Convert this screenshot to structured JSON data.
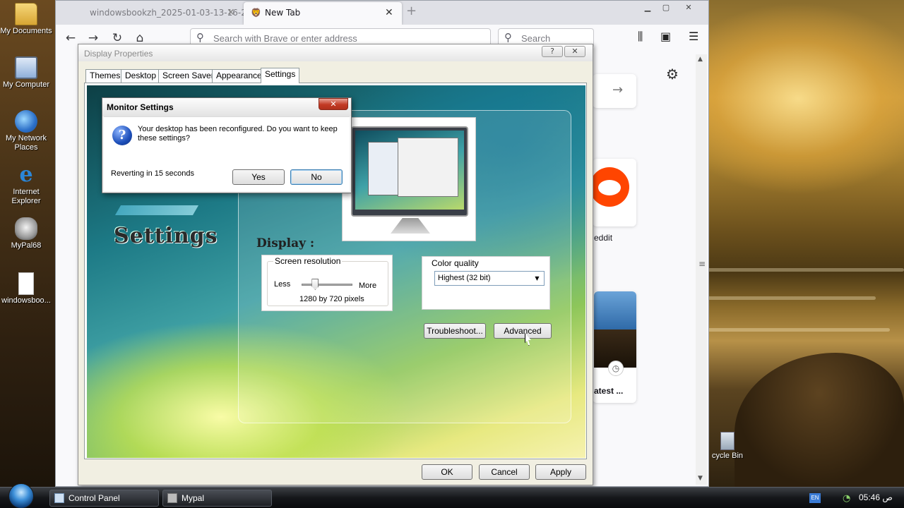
{
  "desktop": {
    "icons": [
      {
        "label": "My Documents",
        "icon": "folder-icon"
      },
      {
        "label": "My Computer",
        "icon": "computer-icon"
      },
      {
        "label": "My Network Places",
        "icon": "network-icon"
      },
      {
        "label": "Internet Explorer",
        "icon": "ie-icon"
      },
      {
        "label": "MyPal68",
        "icon": "mypal-icon"
      },
      {
        "label": "windowsboo...",
        "icon": "file-icon"
      }
    ],
    "recycle_bin_label": "cycle Bin"
  },
  "browser": {
    "tabs": [
      {
        "title": "windowsbookzh_2025-01-03-13-16-2",
        "active": false
      },
      {
        "title": "New Tab",
        "active": true
      }
    ],
    "address_placeholder": "Search with Brave or enter address",
    "search_placeholder": "Search",
    "tiles": [
      {
        "label": "eddit"
      },
      {
        "label": "atest ..."
      }
    ]
  },
  "display_properties": {
    "title": "Display Properties",
    "help_label": "?",
    "close_label": "✕",
    "tabs": [
      "Themes",
      "Desktop",
      "Screen Saver",
      "Appearance",
      "Settings"
    ],
    "active_tab": "Settings",
    "header_word": "Settings",
    "display_label": "Display :",
    "screen_resolution": {
      "title": "Screen resolution",
      "less": "Less",
      "more": "More",
      "value": "1280 by 720 pixels",
      "slider_fraction": 0.2
    },
    "color_quality": {
      "title": "Color quality",
      "selected": "Highest (32 bit)"
    },
    "troubleshoot_label": "Troubleshoot...",
    "advanced_label": "Advanced",
    "ok_label": "OK",
    "cancel_label": "Cancel",
    "apply_label": "Apply"
  },
  "monitor_settings": {
    "title": "Monitor Settings",
    "message": "Your desktop has been reconfigured.  Do you want to keep these settings?",
    "revert_text": "Reverting in 15 seconds",
    "yes_label": "Yes",
    "no_label": "No"
  },
  "taskbar": {
    "items": [
      {
        "label": "Control Panel"
      },
      {
        "label": "Mypal"
      }
    ],
    "language": "EN",
    "time": "05:46 ص"
  },
  "colors": {
    "reddit": "#ff4500",
    "vista_teal": "#1d7a86",
    "close_red": "#c23a24"
  }
}
